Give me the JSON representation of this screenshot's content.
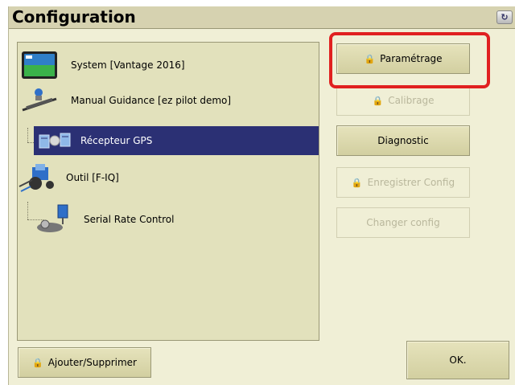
{
  "window": {
    "title": "Configuration",
    "title_icon": "refresh-icon"
  },
  "tree": {
    "items": [
      {
        "label": "System [Vantage 2016]",
        "icon": "display-terminal-icon"
      },
      {
        "label": "Manual Guidance [ez pilot demo]",
        "icon": "guidance-icon"
      },
      {
        "label": "Récepteur GPS",
        "icon": "gps-receiver-icon",
        "selected": true
      },
      {
        "label": "Outil [F-IQ]",
        "icon": "tractor-implement-icon"
      },
      {
        "label": "Serial Rate Control",
        "icon": "rate-control-icon"
      }
    ]
  },
  "buttons": {
    "parametrage": "Paramétrage",
    "calibrage": "Calibrage",
    "diagnostic": "Diagnostic",
    "enregistrer": "Enregistrer Config",
    "changer": "Changer config",
    "ajouter": "Ajouter/Supprimer",
    "ok": "OK."
  },
  "colors": {
    "highlight": "#e02020",
    "selection": "#2b3074",
    "panel_bg": "#f0efd6"
  }
}
